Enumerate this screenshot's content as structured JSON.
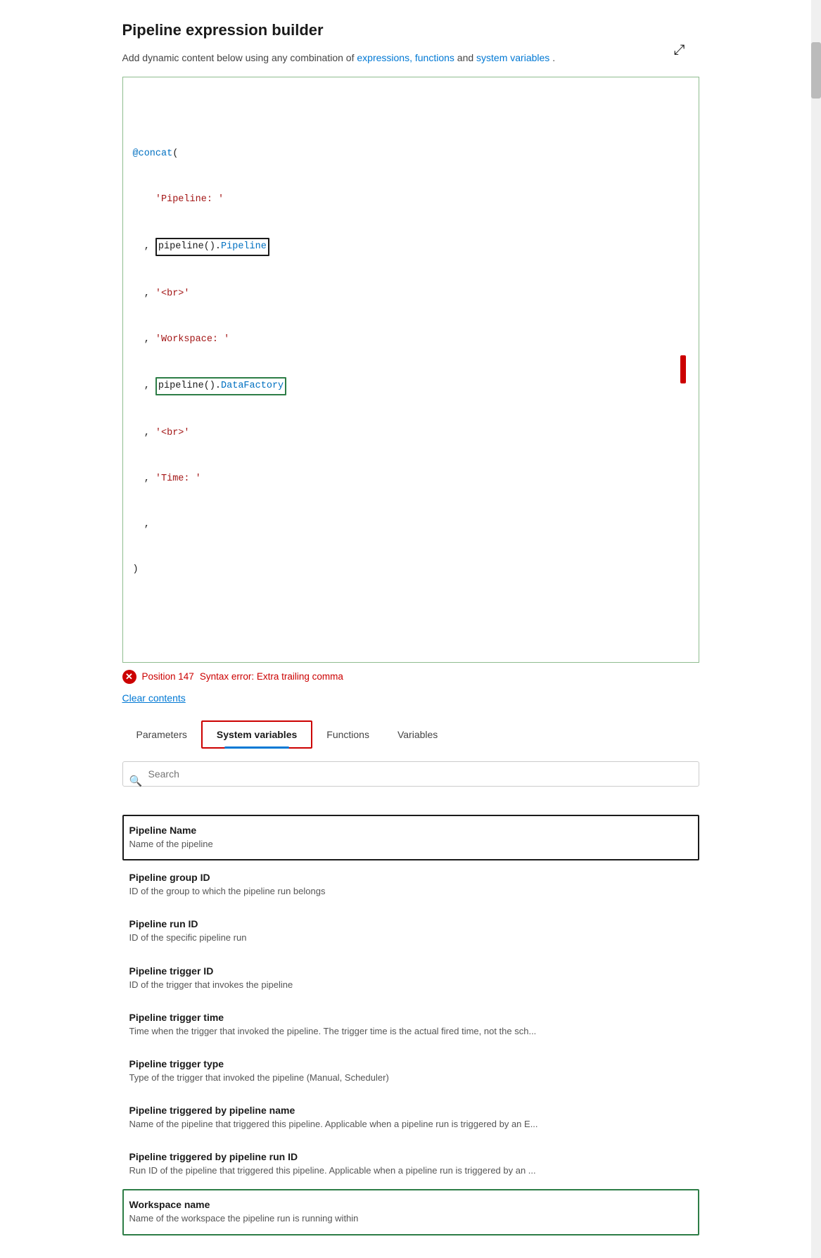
{
  "header": {
    "title": "Pipeline expression builder",
    "expand_icon": "⤢",
    "description_before": "Add dynamic content below using any combination of ",
    "link1": "expressions, functions",
    "link_between": " and ",
    "link2": "system variables",
    "description_after": "."
  },
  "code": {
    "lines": [
      "@concat(",
      "    'Pipeline: '",
      "  , pipeline().Pipeline",
      "  , '<br>'",
      "  , 'Workspace: '",
      "  , pipeline().DataFactory",
      "  , '<br>'",
      "  , 'Time: '",
      "  ,",
      ")"
    ]
  },
  "error": {
    "position_label": "Position 147",
    "message": "Syntax error: Extra trailing comma"
  },
  "clear_contents_label": "Clear contents",
  "tabs": [
    {
      "id": "parameters",
      "label": "Parameters"
    },
    {
      "id": "system-variables",
      "label": "System variables"
    },
    {
      "id": "functions",
      "label": "Functions"
    },
    {
      "id": "variables",
      "label": "Variables"
    }
  ],
  "search": {
    "placeholder": "Search"
  },
  "variables": [
    {
      "id": "pipeline-name",
      "name": "Pipeline Name",
      "description": "Name of the pipeline",
      "highlight": "black"
    },
    {
      "id": "pipeline-group-id",
      "name": "Pipeline group ID",
      "description": "ID of the group to which the pipeline run belongs",
      "highlight": "none"
    },
    {
      "id": "pipeline-run-id",
      "name": "Pipeline run ID",
      "description": "ID of the specific pipeline run",
      "highlight": "none"
    },
    {
      "id": "pipeline-trigger-id",
      "name": "Pipeline trigger ID",
      "description": "ID of the trigger that invokes the pipeline",
      "highlight": "none"
    },
    {
      "id": "pipeline-trigger-time",
      "name": "Pipeline trigger time",
      "description": "Time when the trigger that invoked the pipeline. The trigger time is the actual fired time, not the sch...",
      "highlight": "none"
    },
    {
      "id": "pipeline-trigger-type",
      "name": "Pipeline trigger type",
      "description": "Type of the trigger that invoked the pipeline (Manual, Scheduler)",
      "highlight": "none"
    },
    {
      "id": "pipeline-triggered-by-name",
      "name": "Pipeline triggered by pipeline name",
      "description": "Name of the pipeline that triggered this pipeline. Applicable when a pipeline run is triggered by an E...",
      "highlight": "none"
    },
    {
      "id": "pipeline-triggered-by-run-id",
      "name": "Pipeline triggered by pipeline run ID",
      "description": "Run ID of the pipeline that triggered this pipeline. Applicable when a pipeline run is triggered by an ...",
      "highlight": "none"
    },
    {
      "id": "workspace-name",
      "name": "Workspace name",
      "description": "Name of the workspace the pipeline run is running within",
      "highlight": "green"
    }
  ],
  "colors": {
    "accent_blue": "#0078d4",
    "accent_green": "#2d7d46",
    "accent_red": "#c00",
    "code_string": "#a31515",
    "code_keyword": "#0070c1"
  }
}
